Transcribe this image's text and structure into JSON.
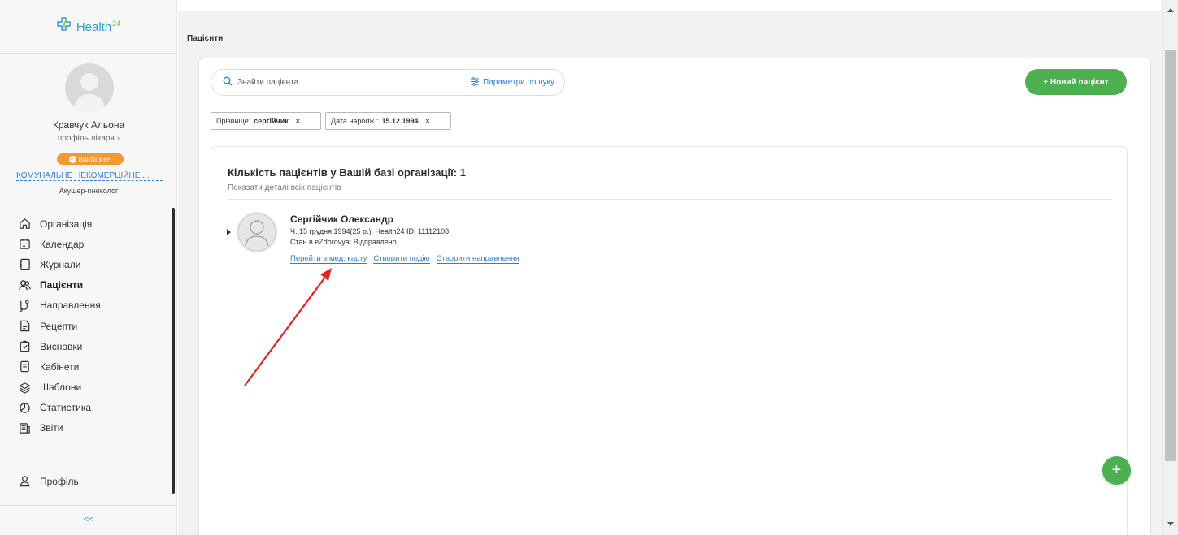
{
  "sidebar": {
    "logo_text": "Health",
    "logo_sup": "24",
    "doctor_name": "Кравчук Альона",
    "profile_link": "профіль лікаря",
    "eh_button": "Вийти з еН",
    "organization": "КОМУНАЛЬНЕ НЕКОМЕРЦІЙНЕ ...",
    "specialty": "Акушер-гінеколог",
    "menu": [
      {
        "label": "Організація",
        "icon": "home-icon"
      },
      {
        "label": "Календар",
        "icon": "calendar-icon"
      },
      {
        "label": "Журнали",
        "icon": "journal-icon"
      },
      {
        "label": "Пацієнти",
        "icon": "patients-icon",
        "active": true
      },
      {
        "label": "Направлення",
        "icon": "referral-icon"
      },
      {
        "label": "Рецепти",
        "icon": "prescription-icon"
      },
      {
        "label": "Висновки",
        "icon": "conclusion-icon"
      },
      {
        "label": "Кабінети",
        "icon": "cabinet-icon"
      },
      {
        "label": "Шаблони",
        "icon": "templates-icon"
      },
      {
        "label": "Статистика",
        "icon": "statistics-icon"
      },
      {
        "label": "Звіти",
        "icon": "reports-icon"
      }
    ],
    "profile_label": "Профіль",
    "collapse_label": "<<"
  },
  "main": {
    "breadcrumb": "Пацієнти",
    "search": {
      "placeholder": "Знайти пацієнта...",
      "params_label": "Параметри пошуку"
    },
    "new_patient_label": "+ Новий пацієнт",
    "filters": [
      {
        "label": "Прізвище:",
        "value": "сергійчик"
      },
      {
        "label": "Дата нарodж.:",
        "value": "15.12.1994"
      }
    ],
    "card": {
      "count_title": "Кількість пацієнтів у Вашій базі організації: 1",
      "details_link": "Показати деталі всіх пацієнтів",
      "patient": {
        "name": "Сергійчик Олександр",
        "info": "Ч.,15 грудня 1994(25 р.), Health24 ID: 11112108",
        "status": "Стан в eZdorovya: Відправлено",
        "links": [
          "Перейти в мед. карту",
          "Створити подію",
          "Створити направлення"
        ]
      }
    },
    "fab_label": "+"
  },
  "colors": {
    "accent_blue": "#2f7fd6",
    "green": "#4caf50",
    "orange": "#f29930",
    "annotation_red": "#e8211f"
  }
}
